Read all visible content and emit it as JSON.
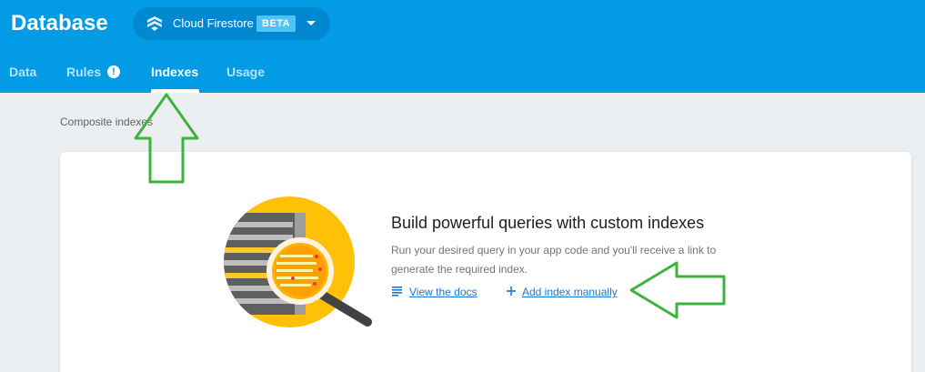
{
  "app": {
    "title": "Database"
  },
  "db_selector": {
    "name": "Cloud Firestore",
    "badge": "BETA",
    "icon": "firestore-icon"
  },
  "tabs": [
    {
      "label": "Data",
      "active": false
    },
    {
      "label": "Rules",
      "active": false,
      "badge": "!"
    },
    {
      "label": "Indexes",
      "active": true
    },
    {
      "label": "Usage",
      "active": false
    }
  ],
  "main": {
    "section_label": "Composite indexes",
    "empty_state": {
      "title": "Build powerful queries with custom indexes",
      "description": "Run your desired query in your app code and you'll receive a link to generate the required index.",
      "docs_link": "View the docs",
      "add_link": "Add index manually"
    }
  },
  "colors": {
    "header": "#039be5",
    "link": "#1976d2",
    "annotation_arrow": "#3db33d"
  }
}
